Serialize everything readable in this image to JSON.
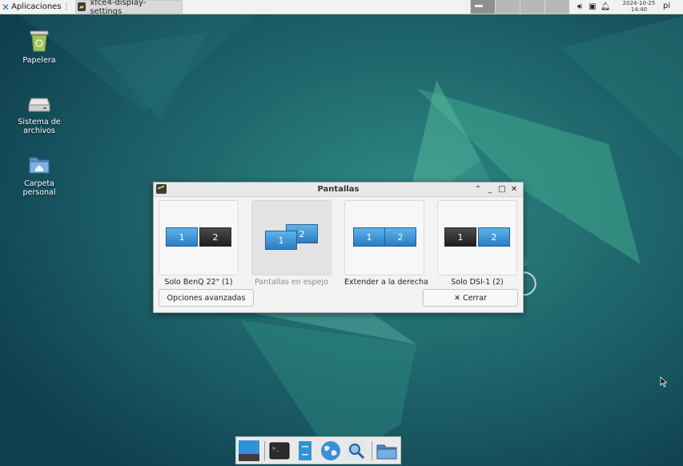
{
  "top_panel": {
    "apps_label": "Aplicaciones",
    "task_label": "xfce4-display-settings",
    "clock_date": "2024-10-25",
    "clock_time": "14:40",
    "user": "pi"
  },
  "desktop_icons": [
    {
      "label": "Papelera",
      "icon": "trash-icon"
    },
    {
      "label": "Sistema de archivos",
      "icon": "drive-icon"
    },
    {
      "label": "Carpeta personal",
      "icon": "home-folder-icon"
    }
  ],
  "window": {
    "title": "Pantallas",
    "options": [
      {
        "label": "Solo BenQ 22\" (1)",
        "screens": [
          "1",
          "2"
        ]
      },
      {
        "label": "Pantallas en espejo",
        "screens": [
          "1",
          "2"
        ]
      },
      {
        "label": "Extender a la derecha",
        "screens": [
          "1",
          "2"
        ]
      },
      {
        "label": "Solo DSI-1 (2)",
        "screens": [
          "1",
          "2"
        ]
      }
    ],
    "advanced_button": "Opciones avanzadas",
    "close_button": "Cerrar"
  },
  "colors": {
    "accent": "#2b7cc4",
    "desktop": "#1c5a63"
  }
}
